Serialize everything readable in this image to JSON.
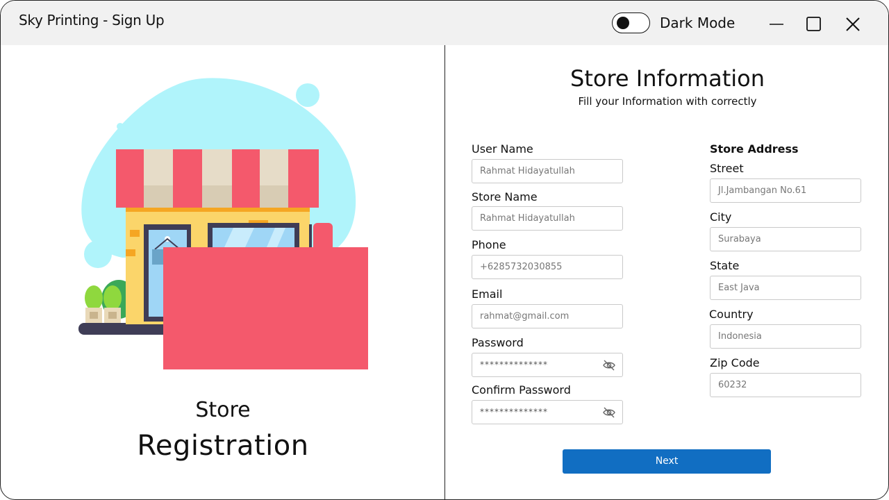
{
  "window": {
    "title": "Sky Printing - Sign Up",
    "dark_mode_label": "Dark Mode",
    "dark_mode_on": false
  },
  "left_panel": {
    "caption_line1": "Store",
    "caption_line2": "Registration",
    "illustration": "store-front-illustration"
  },
  "form": {
    "title": "Store Information",
    "subtitle": "Fill your Information with correctly",
    "fields": {
      "user_name": {
        "label": "User Name",
        "value": "Rahmat Hidayatullah"
      },
      "store_name": {
        "label": "Store Name",
        "value": "Rahmat Hidayatullah"
      },
      "phone": {
        "label": "Phone",
        "value": "+6285732030855"
      },
      "email": {
        "label": "Email",
        "value": "rahmat@gmail.com"
      },
      "password": {
        "label": "Password",
        "value": "**************"
      },
      "confirm_password": {
        "label": "Confirm Password",
        "value": "**************"
      }
    },
    "address": {
      "section_label": "Store Address",
      "street": {
        "label": "Street",
        "value": "Jl.Jambangan No.61"
      },
      "city": {
        "label": "City",
        "value": "Surabaya"
      },
      "state": {
        "label": "State",
        "value": "East Java"
      },
      "country": {
        "label": "Country",
        "value": "Indonesia"
      },
      "zip": {
        "label": "Zip Code",
        "value": "60232"
      }
    },
    "next_label": "Next"
  },
  "colors": {
    "accent": "#116ec2",
    "blob": "#b0f4fb",
    "awning_red": "#f4596c",
    "awning_cream": "#e6dcc8",
    "wall": "#fbd56a",
    "glass": "#9fd6f6"
  }
}
